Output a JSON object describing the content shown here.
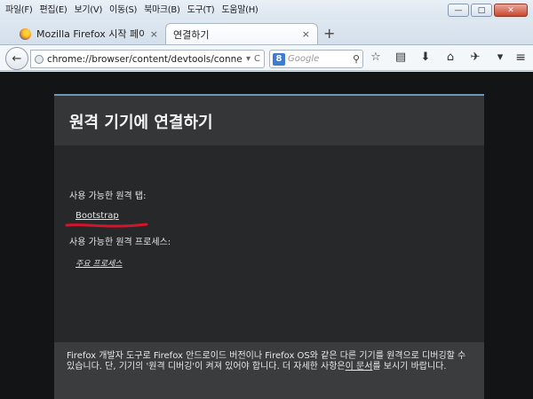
{
  "menubar": {
    "items": [
      "파일(F)",
      "편집(E)",
      "보기(V)",
      "이동(S)",
      "북마크(B)",
      "도구(T)",
      "도움말(H)"
    ]
  },
  "window_controls": {
    "minimize": "—",
    "maximize": "□",
    "close": "✕"
  },
  "tabs": [
    {
      "label": "Mozilla Firefox 시작 페이지",
      "close": "×"
    },
    {
      "label": "연결하기",
      "close": "×"
    }
  ],
  "new_tab": "+",
  "nav": {
    "back": "←",
    "url": "chrome://browser/content/devtools/connect.xhtml",
    "url_dropdown": "▾",
    "reload": "C",
    "search_engine": "8",
    "search_placeholder": "Google",
    "search_button": "⚲"
  },
  "toolbar_icons": [
    "☆",
    "▤",
    "⬇",
    "⌂",
    "✈",
    "▾"
  ],
  "menu_button": "≡",
  "page": {
    "title": "원격 기기에 연결하기",
    "available_tabs_label": "사용 가능한 원격 탭:",
    "tab_link": "Bootstrap",
    "available_processes_label": "사용 가능한 원격 프로세스:",
    "process_link": "주요 프로세스",
    "footer_text_1": "Firefox 개발자 도구로 Firefox 안드로이드 버전이나 Firefox OS와 같은 다른 기기를 원격으로 디버깅할 수 있습니다. 단, 기기의 '원격 디버깅'이 켜져 있어야 합니다. 더 자세한 사항은",
    "footer_link": "이 문서",
    "footer_text_2": "를 보시기 바랍니다."
  },
  "colors": {
    "panel_head": "#343638",
    "panel_body": "#26282a",
    "content_bg": "#121416",
    "annotation": "#d4142a"
  }
}
